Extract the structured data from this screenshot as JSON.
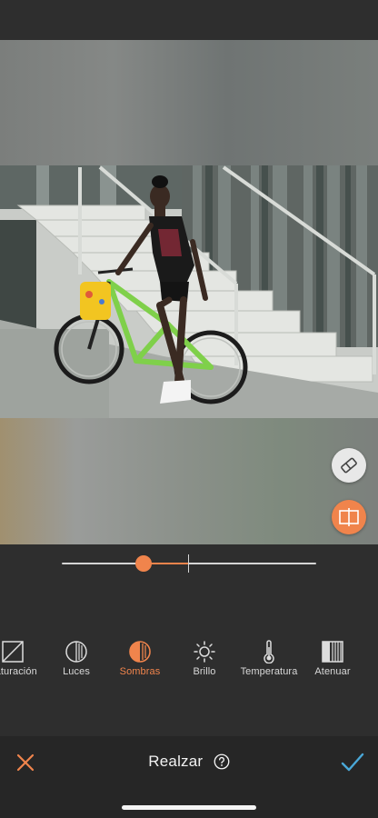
{
  "colors": {
    "accent": "#f0844c",
    "confirm": "#4aa8d8",
    "background": "#2e2e2e",
    "bottom_bar": "#262626"
  },
  "slider": {
    "value_fraction": 0.32,
    "center_fraction": 0.5
  },
  "tools": [
    {
      "label": "Saturación",
      "icon": "saturation-icon",
      "active": false
    },
    {
      "label": "Luces",
      "icon": "highlights-icon",
      "active": false
    },
    {
      "label": "Sombras",
      "icon": "shadows-icon",
      "active": true
    },
    {
      "label": "Brillo",
      "icon": "brightness-icon",
      "active": false
    },
    {
      "label": "Temperatura",
      "icon": "thermometer-icon",
      "active": false
    },
    {
      "label": "Atenuar",
      "icon": "fade-icon",
      "active": false
    }
  ],
  "bottom_bar": {
    "title": "Realzar",
    "help_icon": "help-icon",
    "cancel_icon": "close-icon",
    "confirm_icon": "checkmark-icon"
  },
  "float_buttons": {
    "eraser_icon": "eraser-icon",
    "compare_icon": "compare-icon"
  }
}
